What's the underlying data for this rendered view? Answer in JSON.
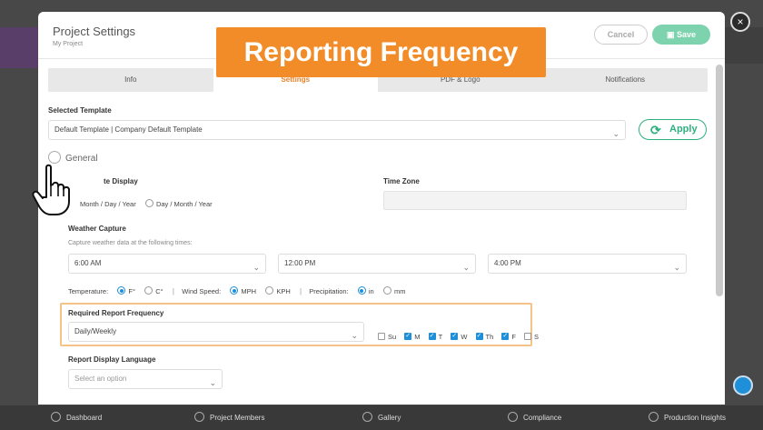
{
  "close_label": "×",
  "header": {
    "title": "Project Settings",
    "subtitle": "My Project",
    "cancel_label": "Cancel",
    "save_label": "Save"
  },
  "callout": "Reporting Frequency",
  "tabs": [
    {
      "label": "Info",
      "active": false
    },
    {
      "label": "Settings",
      "active": true
    },
    {
      "label": "PDF & Logo",
      "active": false
    },
    {
      "label": "Notifications",
      "active": false
    }
  ],
  "template": {
    "label": "Selected Template",
    "value": "Default Template | Company Default Template",
    "apply_label": "Apply"
  },
  "general": {
    "label": "General",
    "date_display_label": "te Display",
    "date_options": [
      "Month / Day / Year",
      "Day / Month / Year"
    ],
    "time_zone_label": "Time Zone"
  },
  "weather": {
    "label": "Weather Capture",
    "hint": "Capture weather data at the following times:",
    "times": [
      "6:00 AM",
      "12:00 PM",
      "4:00 PM"
    ],
    "temperature_label": "Temperature:",
    "temp_options": [
      "F°",
      "C°"
    ],
    "wind_label": "Wind Speed:",
    "wind_options": [
      "MPH",
      "KPH"
    ],
    "precip_label": "Precipitation:",
    "precip_options": [
      "in",
      "mm"
    ]
  },
  "frequency": {
    "label": "Required Report Frequency",
    "value": "Daily/Weekly",
    "days": [
      {
        "label": "Su",
        "checked": false
      },
      {
        "label": "M",
        "checked": true
      },
      {
        "label": "T",
        "checked": true
      },
      {
        "label": "W",
        "checked": true
      },
      {
        "label": "Th",
        "checked": true
      },
      {
        "label": "F",
        "checked": true
      },
      {
        "label": "S",
        "checked": false
      }
    ]
  },
  "language": {
    "label": "Report Display Language",
    "placeholder": "Select an option"
  },
  "bottom_nav": [
    "Dashboard",
    "Project Members",
    "Gallery",
    "Compliance",
    "Production Insights"
  ],
  "colors": {
    "accent": "#f28c28",
    "primary": "#1e8fd8",
    "success": "#2eb07e"
  }
}
